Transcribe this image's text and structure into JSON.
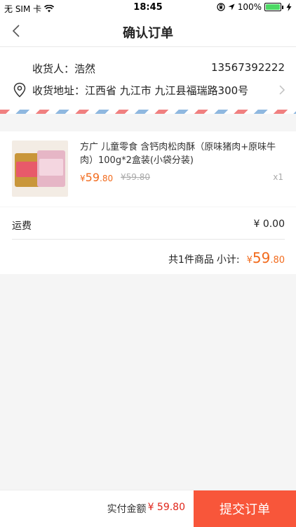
{
  "status_bar": {
    "carrier": "无 SIM 卡",
    "time": "18:45",
    "battery_percent": "100%",
    "battery_level": 1.0,
    "icons": [
      "wifi-icon",
      "orientation-lock-icon",
      "location-arrow-icon",
      "battery-icon",
      "charging-icon"
    ]
  },
  "nav": {
    "title": "确认订单",
    "back_icon": "chevron-left-icon"
  },
  "address": {
    "receiver_label": "收货人：",
    "receiver_name": "浩然",
    "phone": "13567392222",
    "address_label": "收货地址：",
    "address_value": "江西省 九江市 九江县福瑞路300号",
    "location_icon": "location-pin-icon"
  },
  "product": {
    "name": "方广 儿童零食 含钙肉松肉酥（原味猪肉+原味牛肉）100g*2盒装(小袋分装)",
    "price_currency": "¥",
    "price_int": "59",
    "price_dec": ".80",
    "original_price": "¥59.80",
    "quantity": "x1"
  },
  "summary": {
    "shipping_label": "运费",
    "shipping_value": "¥ 0.00",
    "count_label": "共1件商品",
    "subtotal_label": "小计:",
    "subtotal_currency": "¥",
    "subtotal_int": "59",
    "subtotal_dec": ".80"
  },
  "footer": {
    "pay_label": "实付金额",
    "pay_amount": "¥ 59.80",
    "submit_label": "提交订单"
  },
  "colors": {
    "accent": "#f26b1d",
    "submit_bg": "#f8563a",
    "pay_amount": "#e0261b"
  }
}
